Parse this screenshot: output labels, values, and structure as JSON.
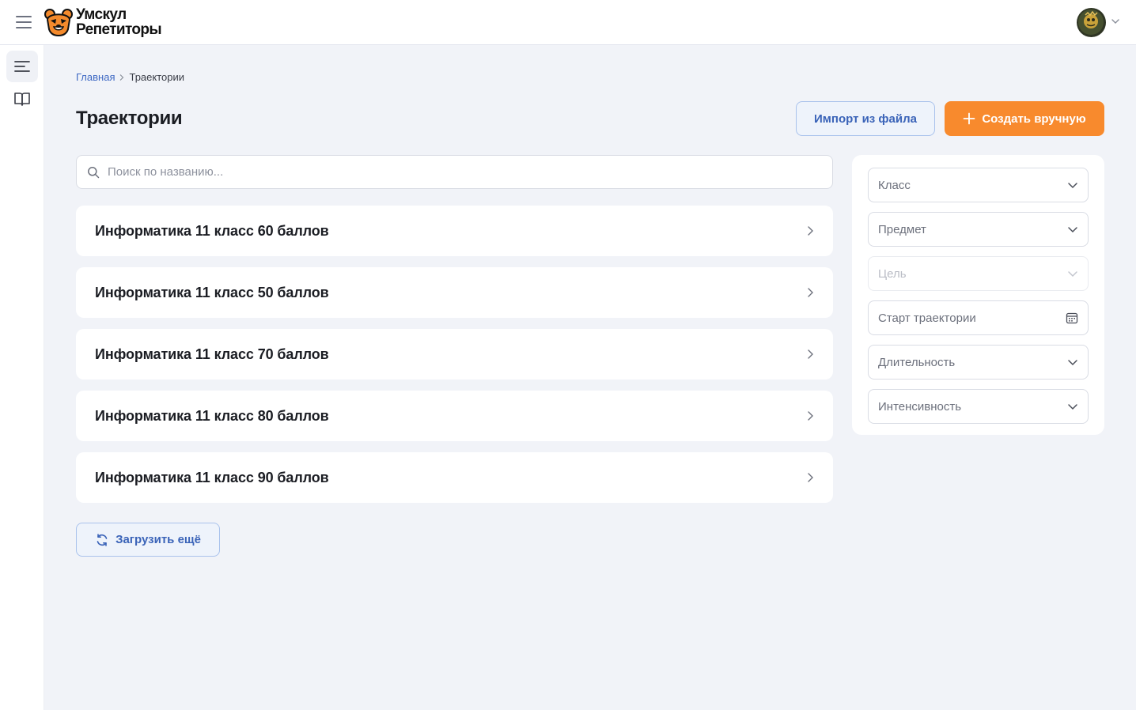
{
  "header": {
    "logo_line1": "Умскул",
    "logo_line2": "Репетиторы"
  },
  "breadcrumb": {
    "home": "Главная",
    "current": "Траектории"
  },
  "page": {
    "title": "Траектории",
    "import_label": "Импорт из файла",
    "create_label": "Создать вручную"
  },
  "search": {
    "placeholder": "Поиск по названию..."
  },
  "items": [
    {
      "title": "Информатика 11 класс 60 баллов"
    },
    {
      "title": "Информатика 11 класс 50 баллов"
    },
    {
      "title": "Информатика 11 класс 70 баллов"
    },
    {
      "title": "Информатика 11 класс 80 баллов"
    },
    {
      "title": "Информатика 11 класс 90 баллов"
    }
  ],
  "load_more_label": "Загрузить ещё",
  "filters": {
    "grade": "Класс",
    "subject": "Предмет",
    "goal": "Цель",
    "start": "Старт траектории",
    "duration": "Длительность",
    "intensity": "Интенсивность"
  },
  "colors": {
    "accent": "#f88a2d",
    "link": "#3f69c4",
    "background": "#f1f3f8"
  }
}
